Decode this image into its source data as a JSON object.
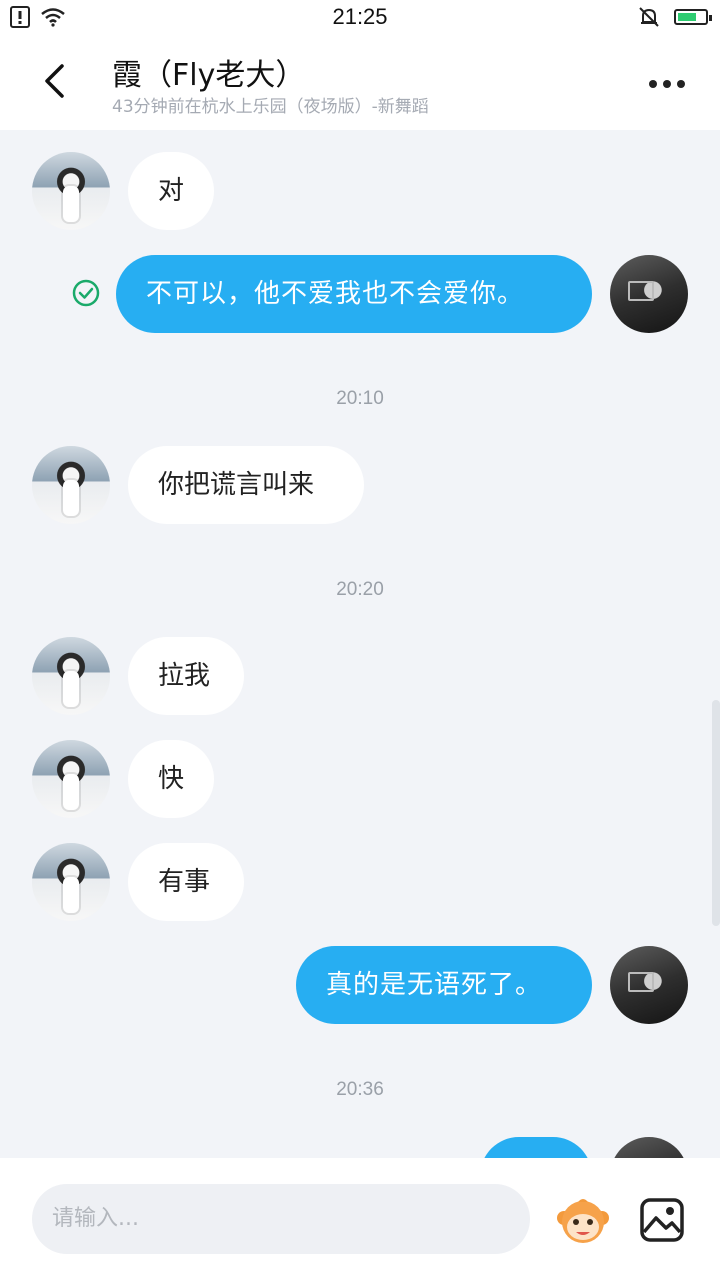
{
  "status_bar": {
    "time": "21:25",
    "battery_color": "#2ecc71"
  },
  "header": {
    "title": "霞（Fly老大）",
    "subtitle": "43分钟前在杭水上乐园（夜场版）-新舞蹈"
  },
  "messages": [
    {
      "from": "friend",
      "text": "对"
    },
    {
      "from": "me",
      "text": "不可以，他不爱我也不会爱你。",
      "read": true
    },
    {
      "time": "20:10"
    },
    {
      "from": "friend",
      "text": "你把谎言叫来"
    },
    {
      "time": "20:20"
    },
    {
      "from": "friend",
      "text": "拉我"
    },
    {
      "from": "friend",
      "text": "快"
    },
    {
      "from": "friend",
      "text": "有事"
    },
    {
      "from": "me",
      "text": "真的是无语死了。"
    },
    {
      "time": "20:36"
    },
    {
      "from": "me",
      "text": ""
    }
  ],
  "input": {
    "placeholder": "请输入..."
  },
  "colors": {
    "accent": "#27aef2",
    "background": "#f2f4f8",
    "read_check": "#1aaa6a"
  }
}
